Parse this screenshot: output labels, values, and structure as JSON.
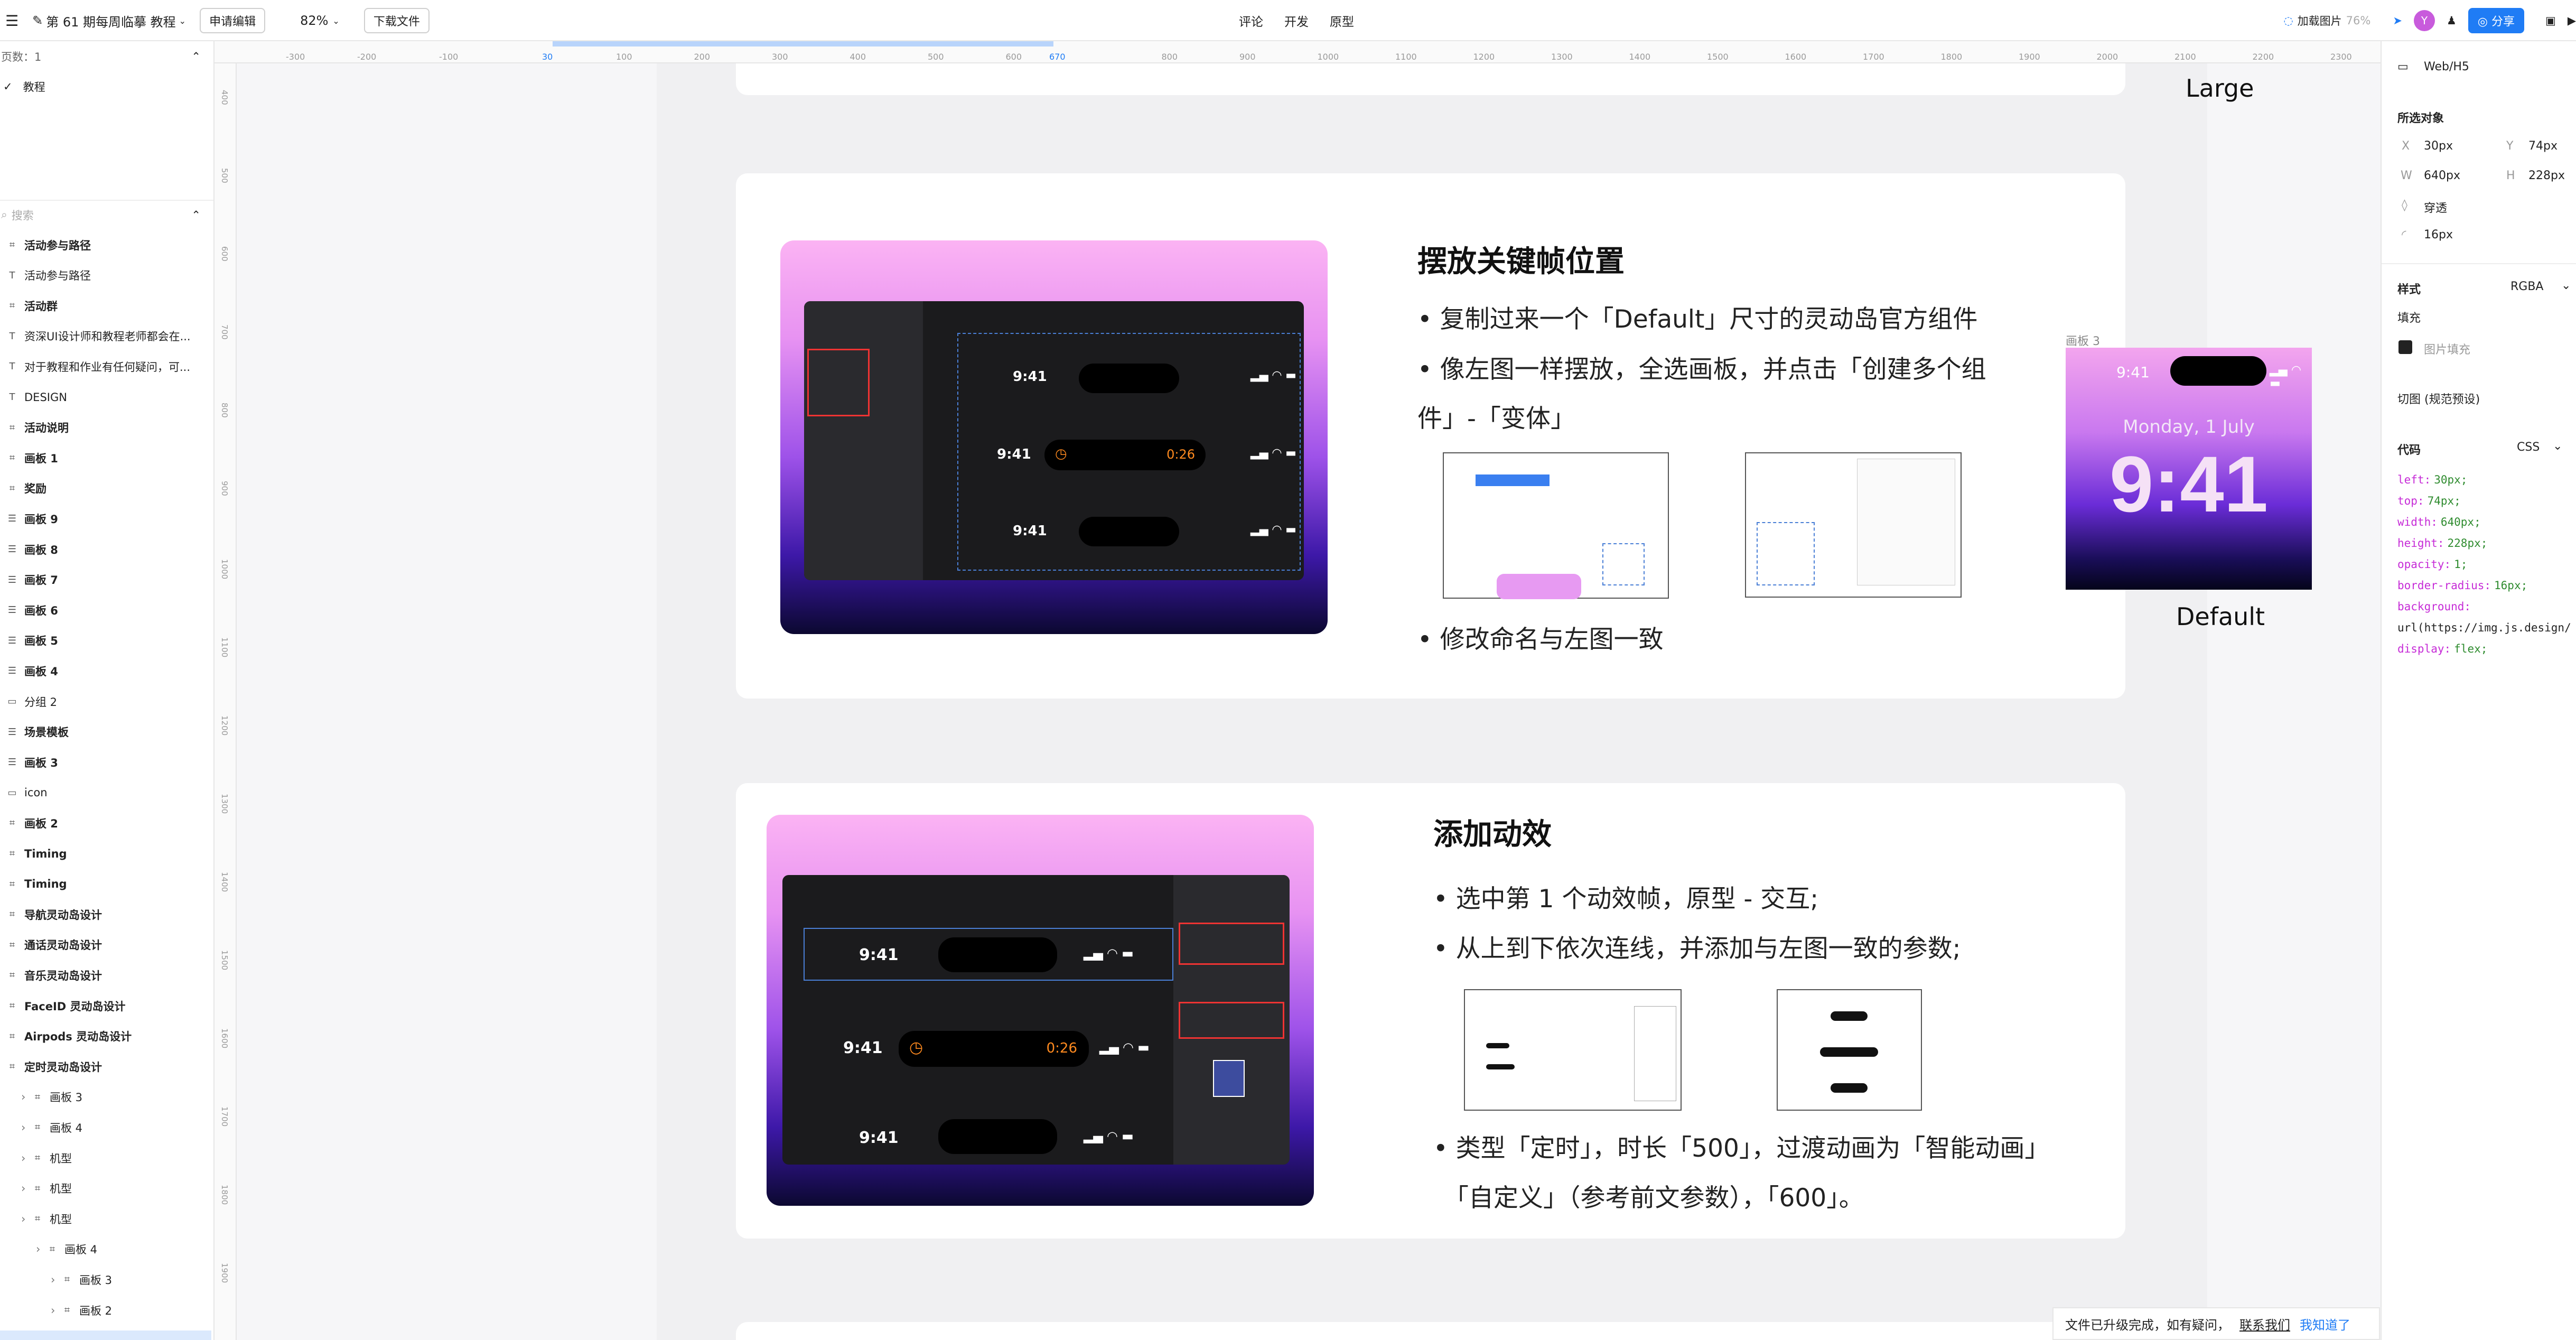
{
  "topbar": {
    "project_title": "第 61 期每周临摹 教程",
    "apply_edit": "申请编辑",
    "zoom": "82%",
    "download": "下载文件",
    "tabs": [
      "评论",
      "开发",
      "原型"
    ],
    "load_image": "加载图片",
    "load_percent": "76%",
    "avatar_letter": "Y",
    "share": "分享"
  },
  "leftpanel": {
    "pages_label": "页数：1",
    "page_item": "教程",
    "search_placeholder": "搜索",
    "layers": [
      {
        "label": "活动参与路径",
        "icon": "frame-icon",
        "bold": true,
        "indent": 0
      },
      {
        "label": "活动参与路径",
        "icon": "text-icon",
        "bold": false,
        "indent": 0
      },
      {
        "label": "活动群",
        "icon": "frame-icon",
        "bold": true,
        "indent": 0
      },
      {
        "label": "资深UI设计师和教程老师都会在...",
        "icon": "text-icon",
        "bold": false,
        "indent": 0
      },
      {
        "label": "对于教程和作业有任何疑问，可...",
        "icon": "text-icon",
        "bold": false,
        "indent": 0
      },
      {
        "label": "DESIGN",
        "icon": "text-icon",
        "bold": false,
        "indent": 0
      },
      {
        "label": "活动说明",
        "icon": "frame-icon",
        "bold": true,
        "indent": 0
      },
      {
        "label": "画板 1",
        "icon": "frame-icon",
        "bold": true,
        "indent": 0
      },
      {
        "label": "奖励",
        "icon": "frame-icon",
        "bold": true,
        "indent": 0
      },
      {
        "label": "画板 9",
        "icon": "list-icon",
        "bold": true,
        "indent": 0
      },
      {
        "label": "画板 8",
        "icon": "list-icon",
        "bold": true,
        "indent": 0
      },
      {
        "label": "画板 7",
        "icon": "list-icon",
        "bold": true,
        "indent": 0
      },
      {
        "label": "画板 6",
        "icon": "list-icon",
        "bold": true,
        "indent": 0
      },
      {
        "label": "画板 5",
        "icon": "list-icon",
        "bold": true,
        "indent": 0
      },
      {
        "label": "画板 4",
        "icon": "list-icon",
        "bold": true,
        "indent": 0
      },
      {
        "label": "分组 2",
        "icon": "folder-icon",
        "bold": false,
        "indent": 0
      },
      {
        "label": "场景模板",
        "icon": "list-icon",
        "bold": true,
        "indent": 0
      },
      {
        "label": "画板 3",
        "icon": "list-icon",
        "bold": true,
        "indent": 0
      },
      {
        "label": "icon",
        "icon": "folder-icon",
        "bold": false,
        "indent": 0
      },
      {
        "label": "画板 2",
        "icon": "frame-icon",
        "bold": true,
        "indent": 0
      },
      {
        "label": "Timing",
        "icon": "frame-icon",
        "bold": true,
        "indent": 0
      },
      {
        "label": "Timing",
        "icon": "frame-icon",
        "bold": true,
        "indent": 0
      },
      {
        "label": "导航灵动岛设计",
        "icon": "frame-icon",
        "bold": true,
        "indent": 0
      },
      {
        "label": "通话灵动岛设计",
        "icon": "frame-icon",
        "bold": true,
        "indent": 0
      },
      {
        "label": "音乐灵动岛设计",
        "icon": "frame-icon",
        "bold": true,
        "indent": 0
      },
      {
        "label": "FaceID 灵动岛设计",
        "icon": "frame-icon",
        "bold": true,
        "indent": 0
      },
      {
        "label": "Airpods 灵动岛设计",
        "icon": "frame-icon",
        "bold": true,
        "indent": 0
      },
      {
        "label": "定时灵动岛设计",
        "icon": "frame-icon",
        "bold": true,
        "indent": 0
      },
      {
        "label": "画板 3",
        "icon": "frame-icon",
        "bold": false,
        "indent": 1
      },
      {
        "label": "画板 4",
        "icon": "frame-icon",
        "bold": false,
        "indent": 1
      },
      {
        "label": "机型",
        "icon": "frame-icon",
        "bold": false,
        "indent": 1
      },
      {
        "label": "机型",
        "icon": "frame-icon",
        "bold": false,
        "indent": 1
      },
      {
        "label": "机型",
        "icon": "frame-icon",
        "bold": false,
        "indent": 1
      },
      {
        "label": "画板 4",
        "icon": "frame-icon",
        "bold": false,
        "indent": 2
      },
      {
        "label": "画板 3",
        "icon": "frame-icon",
        "bold": false,
        "indent": 3
      },
      {
        "label": "画板 2",
        "icon": "frame-icon",
        "bold": false,
        "indent": 3
      }
    ]
  },
  "ruler": {
    "top_ticks": [
      "-300",
      "-200",
      "-100",
      "30",
      "100",
      "200",
      "300",
      "400",
      "500",
      "600",
      "670",
      "800",
      "900",
      "1000",
      "1100",
      "1200",
      "1300",
      "1400",
      "1500",
      "1600",
      "1700",
      "1800",
      "1900",
      "2000",
      "2100",
      "2200",
      "2300"
    ],
    "left_ticks": [
      "400",
      "500",
      "600",
      "700",
      "800",
      "900",
      "1000",
      "1100",
      "1200",
      "1300",
      "1400",
      "1500",
      "1600",
      "1700",
      "1800",
      "1900"
    ]
  },
  "section1": {
    "title": "摆放关键帧位置",
    "bullets": [
      "• 复制过来一个「Default」尺寸的灵动岛官方组件",
      "• 像左图一样摆放，全选画板，并点击「创建多个组",
      "件」-「变体」",
      "• 修改命名与左图一致"
    ],
    "times": [
      "9:41",
      "9:41",
      "9:41"
    ],
    "timer": "0:26"
  },
  "section2": {
    "title": "添加动效",
    "bullets": [
      "• 选中第 1 个动效帧，原型 - 交互;",
      "• 从上到下依次连线，并添加与左图一致的参数;",
      "• 类型「定时」，时长「500」，过渡动画为「智能动画」",
      "「自定义」（参考前文参数），「600」。"
    ],
    "times": [
      "9:41",
      "9:41",
      "9:41"
    ],
    "timer": "0:26"
  },
  "preview": {
    "large_label": "Large",
    "frame_label": "画板 3",
    "status_time": "9:41",
    "date": "Monday, 1 July",
    "clock": "9:41",
    "default_label": "Default"
  },
  "rightpanel": {
    "platform": "Web/H5",
    "selected": "所选对象",
    "x_label": "X",
    "x_value": "30px",
    "y_label": "Y",
    "y_value": "74px",
    "w_label": "W",
    "w_value": "640px",
    "h_label": "H",
    "h_value": "228px",
    "opacity": "穿透",
    "radius": "16px",
    "style_label": "样式",
    "style_value": "RGBA",
    "fill_label": "填充",
    "fill_value": "图片填充",
    "slice_label": "切图 (规范预设)",
    "code_label": "代码",
    "code_lang": "CSS",
    "code_lines": [
      {
        "k": "left:",
        "v": "30px;"
      },
      {
        "k": "top:",
        "v": "74px;"
      },
      {
        "k": "width:",
        "v": "640px;"
      },
      {
        "k": "height:",
        "v": "228px;"
      },
      {
        "k": "opacity:",
        "v": "1;"
      },
      {
        "k": "border-radius:",
        "v": "16px;"
      },
      {
        "k": "background:",
        "v": ""
      },
      {
        "k": "",
        "v": "url(https://img.js.design/"
      },
      {
        "k": "display:",
        "v": "flex;"
      }
    ]
  },
  "toast": {
    "message": "文件已升级完成，如有疑问，",
    "contact": "联系我们",
    "ok": "我知道了"
  }
}
